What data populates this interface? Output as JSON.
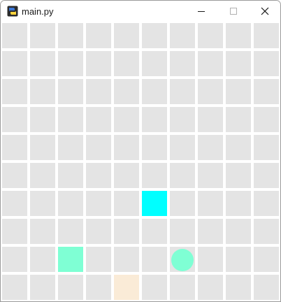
{
  "window": {
    "title": "main.py",
    "app_icon": "python-icon",
    "controls": [
      "minimize-icon",
      "maximize-icon",
      "close-icon"
    ]
  },
  "board": {
    "rows": 10,
    "cols": 10,
    "cell_color": "#e4e4e4",
    "grid_line_color": "#ffffff",
    "pieces": [
      {
        "name": "cyan-square",
        "shape": "square",
        "row": 6,
        "col": 5,
        "color": "#00ffff"
      },
      {
        "name": "aquamarine-square",
        "shape": "square",
        "row": 8,
        "col": 2,
        "color": "#7fffd4"
      },
      {
        "name": "aquamarine-circle",
        "shape": "circle",
        "row": 8,
        "col": 6,
        "color": "#7fffd4"
      },
      {
        "name": "bisque-square",
        "shape": "square",
        "row": 9,
        "col": 4,
        "color": "#faebd7"
      }
    ]
  }
}
